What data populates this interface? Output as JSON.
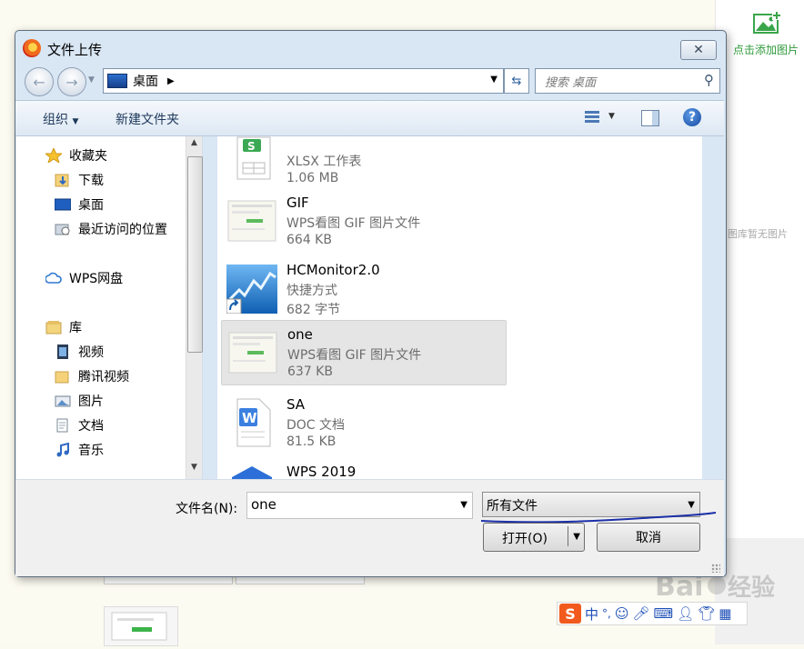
{
  "background": {
    "add_image_label": "点击添加图片",
    "empty_library": "图库暂无图片",
    "watermark": "Baidu 经验"
  },
  "dialog": {
    "title": "文件上传",
    "close_label": "✕",
    "address": {
      "location": "桌面"
    },
    "search": {
      "placeholder": "搜索 桌面"
    },
    "toolbar": {
      "organize": "组织",
      "new_folder": "新建文件夹"
    },
    "nav_pane": {
      "favorites": {
        "label": "收藏夹",
        "items": [
          "下载",
          "桌面",
          "最近访问的位置"
        ]
      },
      "cloud": "WPS网盘",
      "library": {
        "label": "库",
        "items": [
          "视频",
          "腾讯视频",
          "图片",
          "文档",
          "音乐"
        ]
      }
    },
    "files": [
      {
        "name": "",
        "type": "XLSX 工作表",
        "size": "1.06 MB"
      },
      {
        "name": "GIF",
        "type": "WPS看图 GIF 图片文件",
        "size": "664 KB"
      },
      {
        "name": "HCMonitor2.0",
        "type": "快捷方式",
        "size": "682 字节"
      },
      {
        "name": "one",
        "type": "WPS看图 GIF 图片文件",
        "size": "637 KB",
        "selected": true
      },
      {
        "name": "SA",
        "type": "DOC 文档",
        "size": "81.5 KB"
      },
      {
        "name": "WPS 2019",
        "type": "",
        "size": ""
      }
    ],
    "filename": {
      "label": "文件名(N):",
      "value": "one"
    },
    "filetype": {
      "value": "所有文件"
    },
    "buttons": {
      "open": "打开(O)",
      "cancel": "取消"
    }
  },
  "ime": {
    "logo": "S",
    "mode": "中"
  }
}
